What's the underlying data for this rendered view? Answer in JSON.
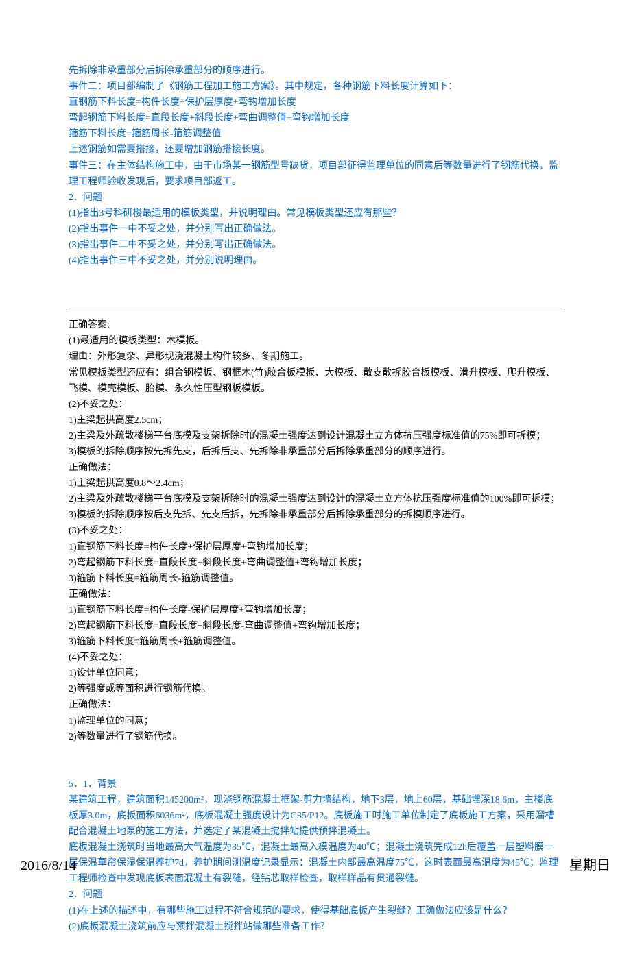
{
  "question4": {
    "bg_lines": [
      "先拆除非承重部分后拆除承重部分的顺序进行。",
      "事件二：项目部编制了《钢筋工程加工施工方案》。其中规定，各种钢筋下料长度计算如下：",
      "直钢筋下料长度=构件长度+保护层厚度+弯钩增加长度",
      "弯起钢筋下料长度=直段长度+斜段长度+弯曲调整值+弯钩增加长度",
      "箍筋下料长度=箍筋周长-箍筋调整值",
      "上述钢筋如需要搭接，还要增加钢筋搭接长度。",
      "事件三：在主体结构施工中，由于市场某一钢筋型号缺货，项目部征得监理单位的同意后等数量进行了钢筋代换，监理工程师验收发现后，要求项目部返工。",
      "2．问题",
      "(1)指出3号科研楼最适用的模板类型，并说明理由。常见模板类型还应有那些？",
      "(2)指出事件一中不妥之处，并分别写出正确做法。",
      "(3)指出事件二中不妥之处，并分别写出正确做法。",
      "(4)指出事件三中不妥之处，并分别说明理由。"
    ]
  },
  "answer4": {
    "header": "正确答案:",
    "lines": [
      "(1)最适用的模板类型：木模板。",
      "理由：外形复杂、异形现浇混凝土构件较多、冬期施工。",
      "常见模板类型还应有：组合钢模板、钢框木(竹)胶合板模板、大模板、散支散拆胶合板模板、滑升模板、爬升模板、飞模、模壳模板、胎模、永久性压型钢板模板。",
      "(2)不妥之处：",
      "1)主梁起拱高度2.5cm；",
      "2)主梁及外疏散楼梯平台底模及支架拆除时的混凝土强度达到设计混凝土立方体抗压强度标准值的75%即可拆模；",
      "3)模板的拆除顺序按先拆先支，后拆后支、先拆除非承重部分后拆除承重部分的顺序进行。",
      "正确做法：",
      "1)主梁起拱高度0.8～2.4cm；",
      "2)主梁及外疏散楼梯平台底模及支架拆除时的混凝土强度达到设计的混凝土立方体抗压强度标准值的100%即可拆模；",
      "3)模板的拆除顺序按后支先拆、先支后拆，先拆除非承重部分后拆除承重部分的拆模顺序进行。",
      "(3)不妥之处：",
      "1)直钢筋下料长度=构件长度+保护层厚度+弯钩增加长度；",
      "2)弯起钢筋下料长度=直段长度+斜段长度+弯曲调整值+弯钩增加长度；",
      "3)箍筋下料长度=箍筋周长-箍筋调整值。",
      "正确做法：",
      "1)直钢筋下料长度=构件长度-保护层厚度+弯钩增加长度；",
      "2)弯起钢筋下料长度=直段长度+斜段长度-弯曲调整值+弯钩增加长度；",
      "3)箍筋下料长度=箍筋周长+箍筋调整值。",
      "(4)不妥之处：",
      "1)设计单位同意；",
      "2)等强度或等面积进行钢筋代换。",
      "正确做法：",
      "1)监理单位的同意；",
      "2)等数量进行了钢筋代换。"
    ]
  },
  "question5": {
    "title": "5．1．背景",
    "lines": [
      "某建筑工程，建筑面积145200m²，现浇钢筋混凝土框架-剪力墙结构，地下3层，地上60层，基础埋深18.6m，主楼底板厚3.0m，底板面积6036m²，底板混凝土强度设计为C35/P12。底板施工时施工单位制定了底板施工方案，采用溜槽配合混凝土地泵的施工方法，并选定了某混凝土搅拌站提供预拌混凝土。",
      "底板混凝土浇筑时当地最高大气温度为35℃，混凝土最高入模温度为40℃；混凝土浇筑完成12h后覆盖一层塑料膜一层保温草帘保湿保温养护7d，养护期间测温度记录显示：混凝土内部最高温度75℃，这时表面最高温度为45℃；监理工程师检查中发现底板表面混凝土有裂缝，经钻芯取样检查，取样样品有贯通裂缝。",
      "2．问题",
      "(1)在上述的描述中，有哪些施工过程不符合规范的要求，使得基础底板产生裂缝？正确做法应该是什么？",
      "(2)底板混凝土浇筑前应与预拌混凝土搅拌站做哪些准备工作？"
    ]
  },
  "footer": {
    "date": "2016/8/14",
    "weekday": "星期日"
  }
}
